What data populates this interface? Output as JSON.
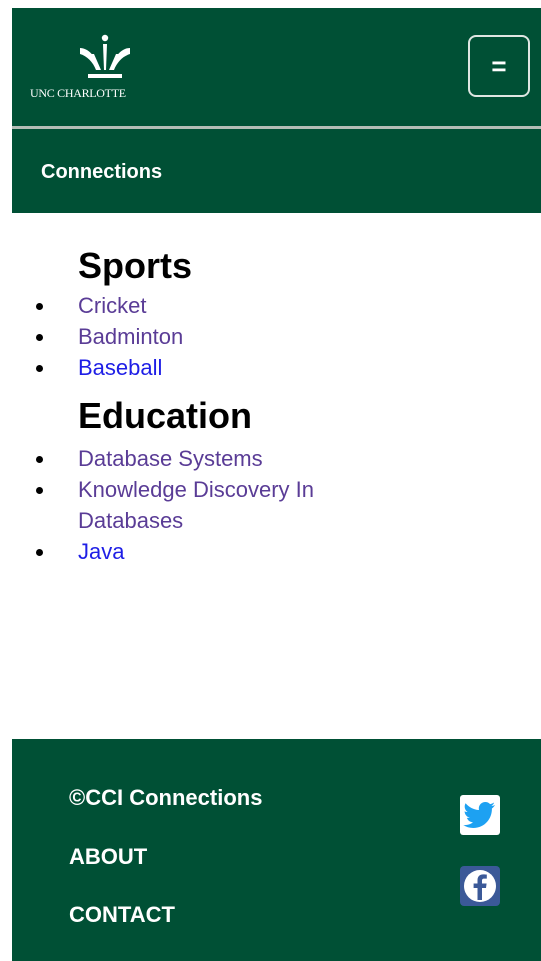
{
  "header": {
    "logo_text": "UNC CHARLOTTE",
    "menu_toggle_glyph": "=",
    "brand_title": "Connections"
  },
  "sections": [
    {
      "heading": "Sports",
      "items": [
        {
          "label": "Cricket",
          "state": "visited"
        },
        {
          "label": "Badminton",
          "state": "visited"
        },
        {
          "label": "Baseball",
          "state": "unvisited"
        }
      ]
    },
    {
      "heading": "Education",
      "items": [
        {
          "label": "Database Systems",
          "state": "visited"
        },
        {
          "label": "Knowledge Discovery In Databases",
          "state": "visited"
        },
        {
          "label": "Java",
          "state": "unvisited"
        }
      ]
    }
  ],
  "footer": {
    "copyright": "©CCI Connections",
    "about": "ABOUT",
    "contact": "CONTACT",
    "social_icons": [
      "twitter-icon",
      "facebook-icon"
    ]
  },
  "colors": {
    "brand_green": "#005035",
    "visited_link": "#5a3c96",
    "unvisited_link": "#1e1ee6",
    "twitter_blue": "#1da1f2",
    "facebook_blue": "#3b5998"
  }
}
